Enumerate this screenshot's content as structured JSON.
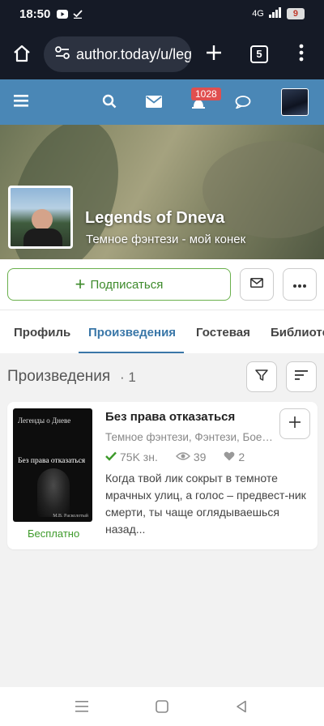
{
  "status_bar": {
    "time": "18:50",
    "network": "4G",
    "battery": "9"
  },
  "browser": {
    "url": "author.today/u/legends_of_dneva",
    "tab_count": "5"
  },
  "site_header": {
    "notifications_count": "1028"
  },
  "profile": {
    "name": "Legends of Dneva",
    "tagline": "Темное фэнтези - мой конек"
  },
  "actions": {
    "subscribe_label": "Подписаться"
  },
  "tabs": [
    {
      "label": "Профиль"
    },
    {
      "label": "Произведения"
    },
    {
      "label": "Гостевая"
    },
    {
      "label": "Библиотека"
    }
  ],
  "works": {
    "heading": "Произведения",
    "count": "· 1",
    "items": [
      {
        "cover_series": "Легенды о Дневе",
        "cover_title": "Без права отказаться",
        "cover_author": "М.В. Расколотый",
        "price_label": "Бесплатно",
        "title": "Без права отказаться",
        "genres": "Темное фэнтези, Фэнтези, Боевое фэнтези",
        "chars": "75K зн.",
        "views": "39",
        "likes": "2",
        "description": "Когда твой лик сокрыт в темноте мрачных улиц, а голос – предвест-ник смерти, ты чаще оглядываешься назад..."
      }
    ]
  },
  "colors": {
    "header": "#4a87b6",
    "accent": "#3a77a8",
    "green": "#3d9a2a",
    "badge": "#e04f4f"
  }
}
